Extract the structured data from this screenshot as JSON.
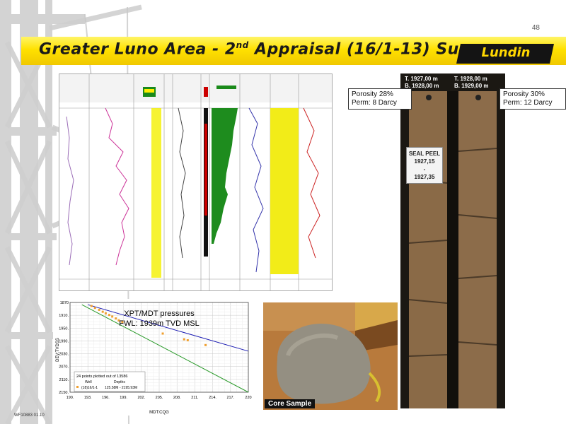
{
  "page": {
    "number": "48",
    "title_main": "Greater Luno Area - 2",
    "title_sup": "nd",
    "title_rest": " Appraisal (16/1-13) Summary",
    "logo": "Lundin",
    "footer_code": "WF10883 01.10",
    "colors": {
      "title_band": "#ffe100",
      "logo_bg": "#141414",
      "logo_text": "#ffd700"
    }
  },
  "core_photo": {
    "depth_labels": [
      "T. 1927,00 m",
      "B. 1928,00 m",
      "T. 1928,00 m",
      "B. 1929,00 m"
    ],
    "callout_left": {
      "line1": "Porosity 28%",
      "line2": "Perm: 8 Darcy"
    },
    "callout_right": {
      "line1": "Porosity 30%",
      "line2": "Perm: 12 Darcy"
    },
    "seal_peel": {
      "line1": "SEAL PEEL",
      "line2": "1927,15",
      "line3": "-",
      "line4": "1927,35"
    }
  },
  "core_sample": {
    "caption": "Core Sample"
  },
  "chart_data": {
    "type": "scatter",
    "title": "XPT/MDT pressures",
    "subtitle": "FWL: 1939m TVD MSL",
    "xlabel": "MDT:CQG",
    "ylabel": "DEV:TVDSS",
    "xlim": [
      190,
      220
    ],
    "ylim": [
      2150,
      1870
    ],
    "x_ticks": [
      "190.",
      "193.",
      "196.",
      "199.",
      "202.",
      "205.",
      "208.",
      "211.",
      "214.",
      "217.",
      "220"
    ],
    "y_ticks": [
      "1870",
      "1910.",
      "1950.",
      "1990.",
      "2030.",
      "2070.",
      "2110.",
      "2150."
    ],
    "legend": {
      "header": "24 points plotted out of 13586",
      "col_well": "Well",
      "col_depths": "Depths",
      "row_well": "(18)16/1-1",
      "row_depths": "125.58M - 2195.93M"
    },
    "grid": true,
    "points": [
      {
        "x": 193.6,
        "y": 1881
      },
      {
        "x": 194.2,
        "y": 1887
      },
      {
        "x": 194.9,
        "y": 1893
      },
      {
        "x": 195.5,
        "y": 1899
      },
      {
        "x": 196.0,
        "y": 1904
      },
      {
        "x": 196.6,
        "y": 1909
      },
      {
        "x": 197.1,
        "y": 1914
      },
      {
        "x": 197.7,
        "y": 1920
      },
      {
        "x": 198.2,
        "y": 1926
      },
      {
        "x": 198.8,
        "y": 1931
      },
      {
        "x": 205.6,
        "y": 1967
      },
      {
        "x": 209.2,
        "y": 1985
      },
      {
        "x": 209.8,
        "y": 1988
      },
      {
        "x": 212.8,
        "y": 2003
      }
    ],
    "lines": [
      {
        "x": [
          192,
          220
        ],
        "y": [
          1877,
          2150
        ],
        "color": "#2a9a2a"
      },
      {
        "x": [
          193,
          220
        ],
        "y": [
          1877,
          2022
        ],
        "color": "#1f1fb4"
      }
    ],
    "colors": {
      "points": "#f0a030"
    }
  }
}
